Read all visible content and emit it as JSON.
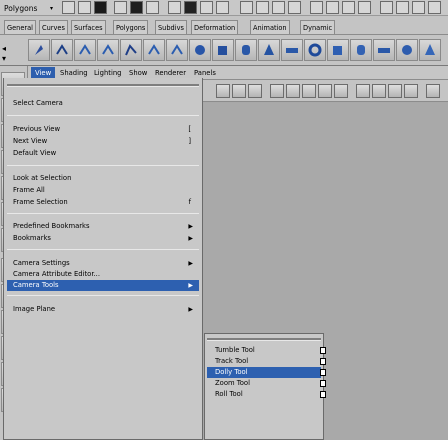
{
  "statusline": {
    "mode_label": "Polygons"
  },
  "shelf": {
    "tabs": [
      "General",
      "Curves",
      "Surfaces",
      "Polygons",
      "Subdivs",
      "Deformation",
      "Animation",
      "Dynamic"
    ]
  },
  "panel": {
    "menus": [
      "View",
      "Shading",
      "Lighting",
      "Show",
      "Renderer",
      "Panels"
    ]
  },
  "view_menu": {
    "items": [
      {
        "label": "Select Camera",
        "shortcut": "",
        "submenu": false
      },
      {
        "label": "Previous View",
        "shortcut": "[",
        "submenu": false
      },
      {
        "label": "Next View",
        "shortcut": "]",
        "submenu": false
      },
      {
        "label": "Default View",
        "shortcut": "",
        "submenu": false
      },
      {
        "label": "Look at Selection",
        "shortcut": "",
        "submenu": false
      },
      {
        "label": "Frame All",
        "shortcut": "",
        "submenu": false
      },
      {
        "label": "Frame Selection",
        "shortcut": "f",
        "submenu": false
      },
      {
        "label": "Predefined Bookmarks",
        "shortcut": "",
        "submenu": true
      },
      {
        "label": "Bookmarks",
        "shortcut": "",
        "submenu": true
      },
      {
        "label": "Camera Settings",
        "shortcut": "",
        "submenu": true
      },
      {
        "label": "Camera Attribute Editor...",
        "shortcut": "",
        "submenu": false
      },
      {
        "label": "Camera Tools",
        "shortcut": "",
        "submenu": true
      },
      {
        "label": "Image Plane",
        "shortcut": "",
        "submenu": true
      }
    ]
  },
  "camera_tools_submenu": {
    "items": [
      {
        "label": "Tumble Tool"
      },
      {
        "label": "Track Tool"
      },
      {
        "label": "Dolly Tool"
      },
      {
        "label": "Zoom Tool"
      },
      {
        "label": "Roll Tool"
      }
    ]
  }
}
